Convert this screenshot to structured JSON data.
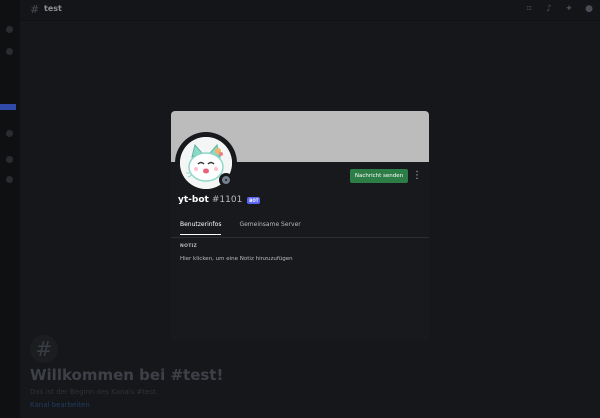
{
  "topbar": {
    "channel_name": "test",
    "icons": [
      "threads-icon",
      "bell-icon",
      "pin-icon",
      "members-icon"
    ]
  },
  "welcome": {
    "hash_symbol": "#",
    "title": "Willkommen bei #test!",
    "subtitle": "Das ist der Beginn des Kanals #test.",
    "link": "Kanal bearbeiten"
  },
  "profile": {
    "username": "yt-bot",
    "discriminator": "#1101",
    "badge": "BOT",
    "send_message_label": "Nachricht senden",
    "more_label": "⋮",
    "tabs": [
      {
        "label": "Benutzerinfos",
        "active": true
      },
      {
        "label": "Gemeinsame Server",
        "active": false
      }
    ],
    "note_heading": "NOTIZ",
    "note_placeholder": "Hier klicken, um eine Notiz hinzuzufügen",
    "banner_color": "#bcbcbc",
    "status_color": "#747f8d"
  },
  "colors": {
    "accent_green": "#2d7d46",
    "bot_badge": "#5865f2",
    "modal_bg": "#18191c"
  }
}
